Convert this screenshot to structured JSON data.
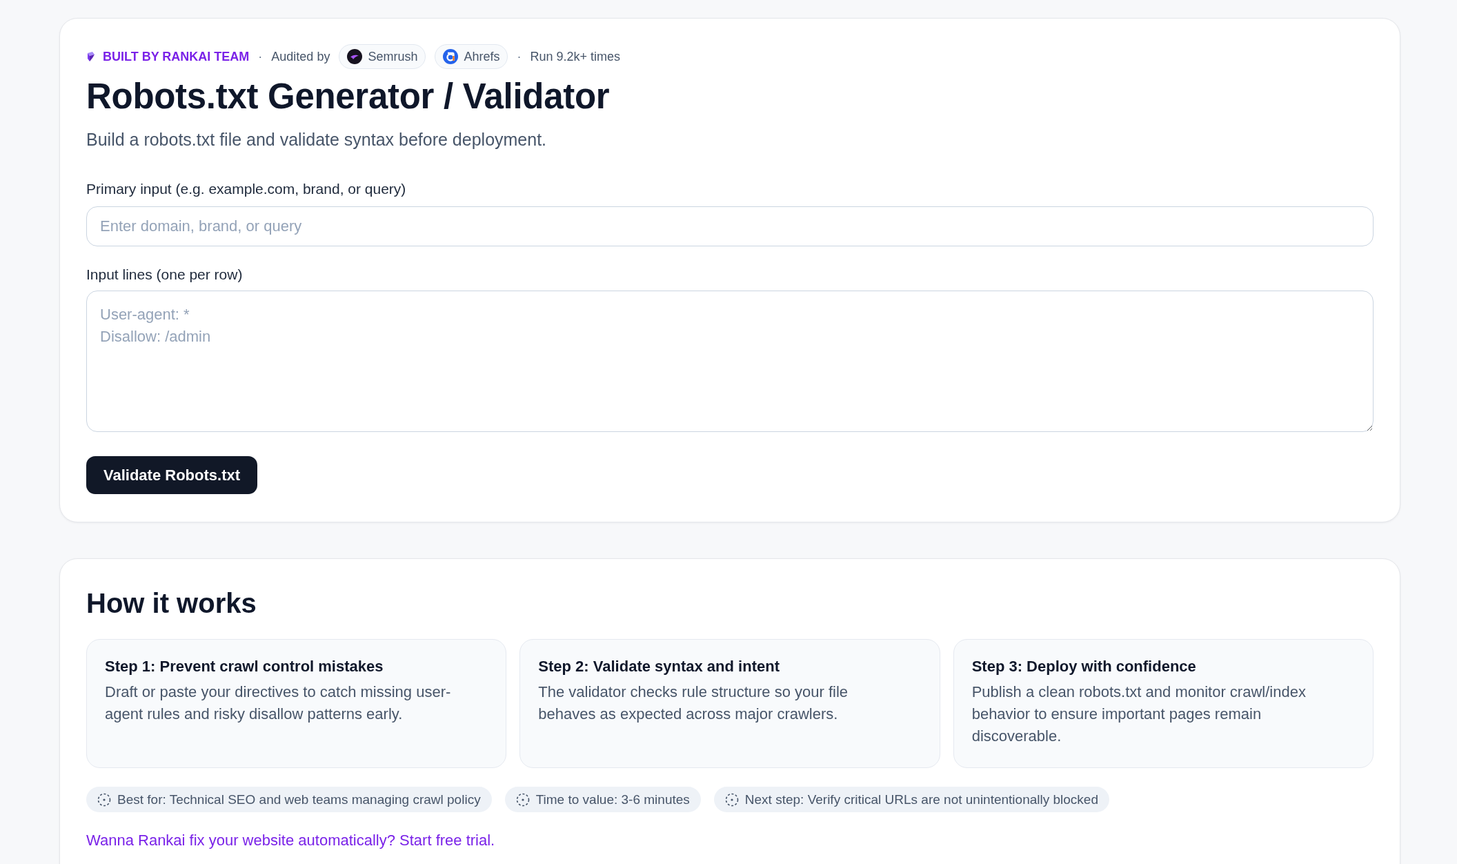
{
  "header": {
    "items": [
      {
        "kind": "brand",
        "text": "BUILT BY RANKAI TEAM"
      },
      {
        "kind": "separator",
        "text": "·"
      },
      {
        "kind": "text",
        "text": "Audited by"
      },
      {
        "kind": "chip",
        "text": "Semrush"
      },
      {
        "kind": "chip",
        "text": "Ahrefs"
      },
      {
        "kind": "separator",
        "text": "·"
      },
      {
        "kind": "text",
        "text": "Run 9.2k+ times"
      }
    ]
  },
  "title": "Robots.txt Generator / Validator",
  "subtitle": "Build a robots.txt file and validate syntax before deployment.",
  "primary_input": {
    "label": "Primary input (e.g. example.com, brand, or query)",
    "placeholder": "Enter domain, brand, or query"
  },
  "input_lines": {
    "label": "Input lines (one per row)",
    "placeholder": "User-agent: *\nDisallow: /admin"
  },
  "button": "Validate Robots.txt",
  "how_it_works": {
    "title": "How it works",
    "steps": [
      {
        "title": "Step 1: Prevent crawl control mistakes",
        "text": "Draft or paste your directives to catch missing user-agent rules and risky disallow patterns early."
      },
      {
        "title": "Step 2: Validate syntax and intent",
        "text": "The validator checks rule structure so your file behaves as expected across major crawlers."
      },
      {
        "title": "Step 3: Deploy with confidence",
        "text": "Publish a clean robots.txt and monitor crawl/index behavior to ensure important pages remain discoverable."
      }
    ],
    "chips": [
      "Best for: Technical SEO and web teams managing crawl policy",
      "Time to value: 3-6 minutes",
      "Next step: Verify critical URLs are not unintentionally blocked"
    ],
    "link": "Wanna Rankai fix your website automatically? Start free trial."
  }
}
